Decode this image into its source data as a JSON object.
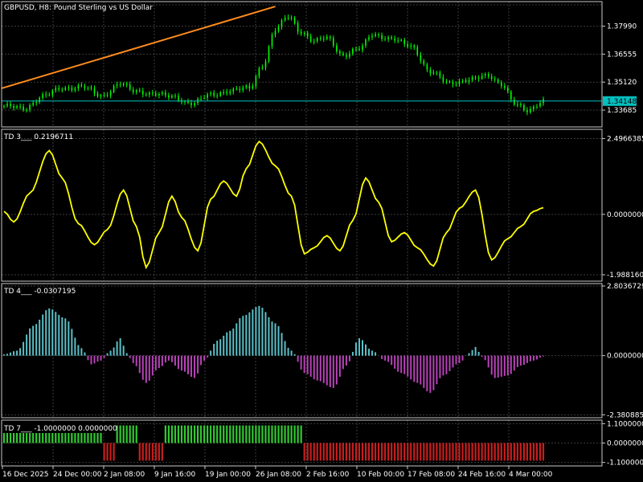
{
  "window": {
    "symbol_title": "GBPUSD, H8:  Pound Sterling vs US Dollar"
  },
  "colors": {
    "background": "#000000",
    "grid": "#3c3c3c",
    "frame": "#c8c8c8",
    "bull_candle": "#00ff00",
    "price_line": "#00c0c0",
    "trendline": "#ff8c1e",
    "td3_line": "#ffff00",
    "td4_positive": "#5bc0c8",
    "td4_negative": "#b842b8",
    "td7_positive": "#32c832",
    "td7_negative": "#c81e1e",
    "bid_label_bg": "#00c0c0"
  },
  "main_panel": {
    "name": "price",
    "y_ticks": [
      {
        "label": "1.37990",
        "value": 1.3799
      },
      {
        "label": "1.36555",
        "value": 1.36555
      },
      {
        "label": "1.35120",
        "value": 1.3512
      },
      {
        "label": "1.33685",
        "value": 1.33685
      }
    ],
    "current_price": {
      "label": "1.34148",
      "value": 1.34148
    },
    "ylim": [
      1.3282,
      1.3925
    ]
  },
  "indicators": [
    {
      "id": "td3",
      "label": "TD 3___  0.2196711",
      "y_ticks": [
        {
          "label": "2.4966385",
          "value": 2.4966385
        },
        {
          "label": "0.0000000",
          "value": 0
        },
        {
          "label": "-1.9881607",
          "value": -1.9881607
        }
      ],
      "ylim": [
        -2.2,
        2.8
      ]
    },
    {
      "id": "td4",
      "label": "TD 4___  -0.0307195",
      "y_ticks": [
        {
          "label": "2.8036729",
          "value": 2.8036729
        },
        {
          "label": "0.0000000",
          "value": 0
        },
        {
          "label": "-2.3808855",
          "value": -2.3808855
        }
      ],
      "ylim": [
        -2.5,
        2.9
      ]
    },
    {
      "id": "td7",
      "label": "TD 7___  -1.0000000 0.0000000",
      "y_ticks": [
        {
          "label": "1.1000000",
          "value": 1.1
        },
        {
          "label": "0.0000000",
          "value": 0
        },
        {
          "label": "-1.1000000",
          "value": -1.1
        }
      ],
      "ylim": [
        -1.3,
        1.3
      ]
    }
  ],
  "x_axis": {
    "ticks": [
      "16 Dec 2025",
      "24 Dec 00:00",
      "2 Jan 08:00",
      "9 Jan 16:00",
      "19 Jan 00:00",
      "26 Jan 08:00",
      "2 Feb 16:00",
      "10 Feb 00:00",
      "17 Feb 08:00",
      "24 Feb 16:00",
      "4 Mar 00:00"
    ]
  },
  "chart_data": {
    "type": "line",
    "bars_count": 168,
    "price_anchors": [
      [
        0,
        1.339
      ],
      [
        6,
        1.3375
      ],
      [
        12,
        1.344
      ],
      [
        18,
        1.348
      ],
      [
        24,
        1.349
      ],
      [
        30,
        1.344
      ],
      [
        36,
        1.3505
      ],
      [
        40,
        1.3465
      ],
      [
        46,
        1.3455
      ],
      [
        52,
        1.3435
      ],
      [
        58,
        1.3405
      ],
      [
        64,
        1.3445
      ],
      [
        70,
        1.347
      ],
      [
        76,
        1.348
      ],
      [
        80,
        1.36
      ],
      [
        84,
        1.378
      ],
      [
        88,
        1.385
      ],
      [
        92,
        1.377
      ],
      [
        96,
        1.372
      ],
      [
        100,
        1.374
      ],
      [
        105,
        1.365
      ],
      [
        110,
        1.368
      ],
      [
        114,
        1.376
      ],
      [
        120,
        1.373
      ],
      [
        126,
        1.37
      ],
      [
        132,
        1.356
      ],
      [
        138,
        1.351
      ],
      [
        144,
        1.352
      ],
      [
        150,
        1.355
      ],
      [
        154,
        1.35
      ],
      [
        158,
        1.34
      ],
      [
        162,
        1.337
      ],
      [
        167,
        1.3414
      ]
    ],
    "trendline": {
      "from": [
        0,
        1.348
      ],
      "to": [
        84,
        1.39
      ]
    },
    "td3_anchors": [
      [
        0,
        0.1
      ],
      [
        3,
        -0.25
      ],
      [
        8,
        0.7
      ],
      [
        14,
        2.1
      ],
      [
        18,
        1.2
      ],
      [
        23,
        -0.3
      ],
      [
        28,
        -1.0
      ],
      [
        32,
        -0.5
      ],
      [
        37,
        0.8
      ],
      [
        41,
        -0.4
      ],
      [
        44,
        -1.75
      ],
      [
        48,
        -0.6
      ],
      [
        52,
        0.6
      ],
      [
        55,
        -0.1
      ],
      [
        60,
        -1.2
      ],
      [
        64,
        0.5
      ],
      [
        68,
        1.1
      ],
      [
        72,
        0.6
      ],
      [
        75,
        1.5
      ],
      [
        79,
        2.4
      ],
      [
        84,
        1.6
      ],
      [
        89,
        0.6
      ],
      [
        93,
        -1.3
      ],
      [
        96,
        -1.1
      ],
      [
        100,
        -0.7
      ],
      [
        104,
        -1.2
      ],
      [
        108,
        -0.2
      ],
      [
        112,
        1.2
      ],
      [
        116,
        0.4
      ],
      [
        120,
        -0.9
      ],
      [
        124,
        -0.6
      ],
      [
        128,
        -1.1
      ],
      [
        133,
        -1.7
      ],
      [
        137,
        -0.6
      ],
      [
        141,
        0.2
      ],
      [
        146,
        0.8
      ],
      [
        151,
        -1.5
      ],
      [
        156,
        -0.8
      ],
      [
        160,
        -0.4
      ],
      [
        164,
        0.1
      ],
      [
        167,
        0.22
      ]
    ],
    "td4_anchors": [
      [
        0,
        0.05
      ],
      [
        4,
        0.2
      ],
      [
        9,
        1.2
      ],
      [
        14,
        1.9
      ],
      [
        19,
        1.5
      ],
      [
        24,
        0.3
      ],
      [
        27,
        -0.35
      ],
      [
        30,
        -0.2
      ],
      [
        33,
        0.2
      ],
      [
        36,
        0.7
      ],
      [
        38,
        0.1
      ],
      [
        40,
        -0.3
      ],
      [
        44,
        -1.1
      ],
      [
        48,
        -0.5
      ],
      [
        51,
        -0.2
      ],
      [
        55,
        -0.6
      ],
      [
        59,
        -0.9
      ],
      [
        62,
        -0.2
      ],
      [
        66,
        0.6
      ],
      [
        70,
        1.0
      ],
      [
        74,
        1.6
      ],
      [
        79,
        2.0
      ],
      [
        84,
        1.3
      ],
      [
        89,
        0.2
      ],
      [
        93,
        -0.7
      ],
      [
        97,
        -1.0
      ],
      [
        102,
        -1.3
      ],
      [
        106,
        -0.4
      ],
      [
        110,
        0.7
      ],
      [
        114,
        0.2
      ],
      [
        118,
        -0.2
      ],
      [
        123,
        -0.7
      ],
      [
        128,
        -1.1
      ],
      [
        132,
        -1.5
      ],
      [
        136,
        -0.8
      ],
      [
        141,
        -0.3
      ],
      [
        144,
        0.1
      ],
      [
        146,
        0.35
      ],
      [
        148,
        -0.05
      ],
      [
        152,
        -0.9
      ],
      [
        156,
        -0.8
      ],
      [
        160,
        -0.4
      ],
      [
        164,
        -0.2
      ],
      [
        167,
        -0.03
      ]
    ],
    "td7_segments": [
      {
        "from": 0,
        "to": 30,
        "value": 1
      },
      {
        "from": 31,
        "to": 34,
        "value": -1
      },
      {
        "from": 35,
        "to": 41,
        "value": 1
      },
      {
        "from": 42,
        "to": 49,
        "value": -1
      },
      {
        "from": 50,
        "to": 92,
        "value": 1
      },
      {
        "from": 93,
        "to": 167,
        "value": -1
      }
    ]
  }
}
